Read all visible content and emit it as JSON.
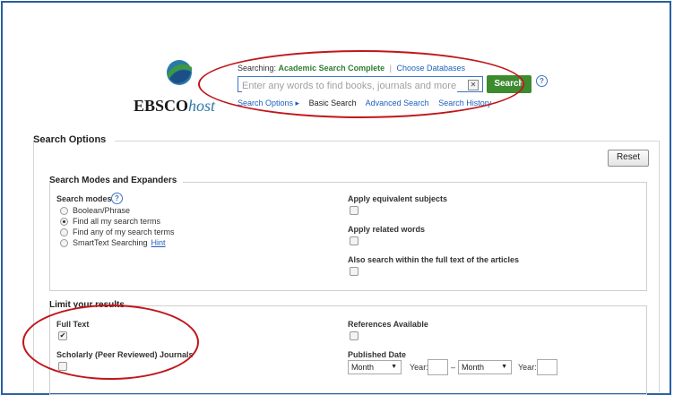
{
  "header": {
    "logo_text": "EBSCO",
    "logo_text_italic": "host",
    "searching_label": "Searching:",
    "database": "Academic Search Complete",
    "choose_databases": "Choose Databases",
    "search_placeholder": "Enter any words to find books, journals and more",
    "search_button": "Search",
    "help": "?",
    "nav": {
      "search_options": "Search Options ▸",
      "basic_search": "Basic Search",
      "advanced_search": "Advanced Search",
      "search_history": "Search History"
    },
    "colors": {
      "accent_green": "#3c8b2e",
      "link_blue": "#1e5fbf",
      "annotation_red": "#c0161b"
    }
  },
  "search_options": {
    "title": "Search Options",
    "reset_button": "Reset",
    "modes": {
      "title": "Search Modes and Expanders",
      "search_modes_label": "Search modes",
      "help": "?",
      "options": [
        {
          "label": "Boolean/Phrase",
          "selected": false
        },
        {
          "label": "Find all my search terms",
          "selected": true
        },
        {
          "label": "Find any of my search terms",
          "selected": false
        },
        {
          "label": "SmartText Searching",
          "selected": false
        }
      ],
      "hint": "Hint",
      "expanders": [
        {
          "label": "Apply equivalent subjects",
          "checked": false
        },
        {
          "label": "Apply related words",
          "checked": false
        },
        {
          "label": "Also search within the full text of the articles",
          "checked": false
        }
      ]
    },
    "limits": {
      "title": "Limit your results",
      "full_text": {
        "label": "Full Text",
        "checked": true
      },
      "scholarly": {
        "label": "Scholarly (Peer Reviewed) Journals",
        "checked": false
      },
      "references": {
        "label": "References Available",
        "checked": false
      },
      "published_date": {
        "label": "Published Date",
        "from_month": "Month",
        "year_label": "Year:",
        "dash": "–",
        "to_month": "Month",
        "year_label_2": "Year:"
      }
    }
  }
}
